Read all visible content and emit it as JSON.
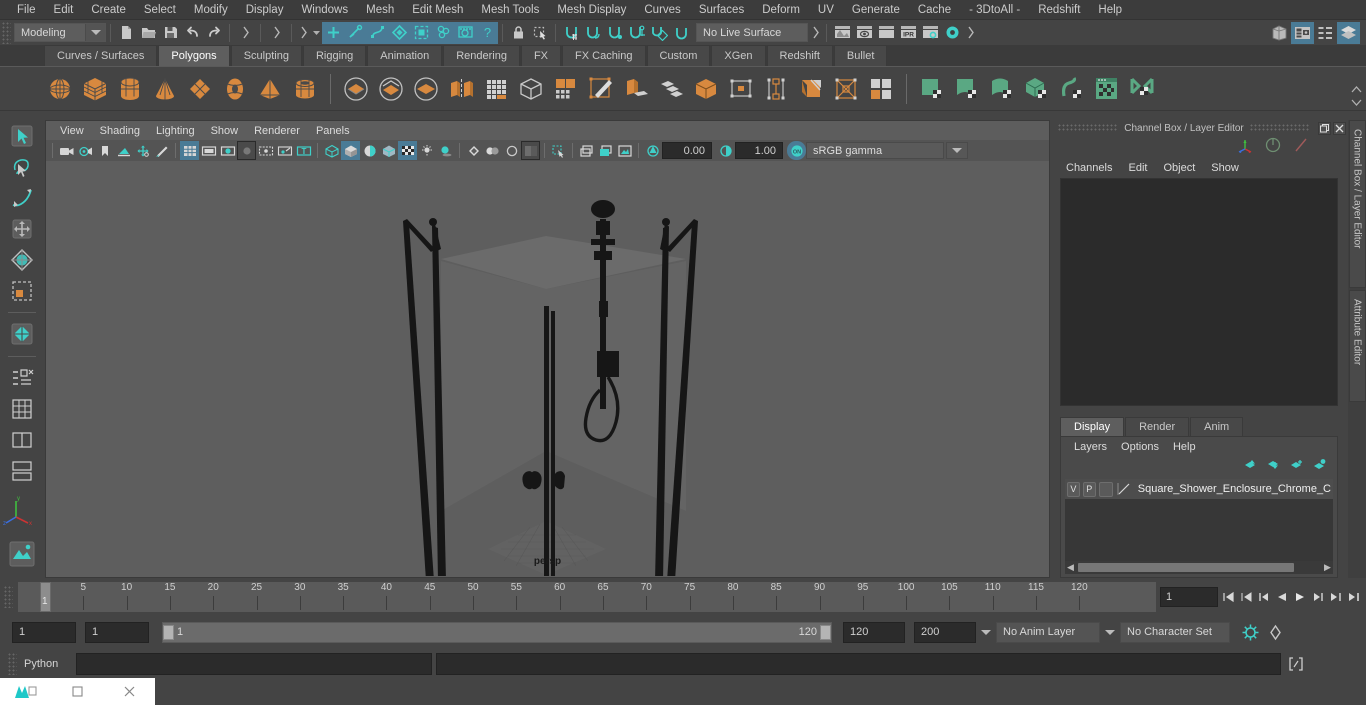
{
  "app": {
    "name": "Autodesk Maya"
  },
  "menubar": {
    "items": [
      "File",
      "Edit",
      "Create",
      "Select",
      "Modify",
      "Display",
      "Windows",
      "Mesh",
      "Edit Mesh",
      "Mesh Tools",
      "Mesh Display",
      "Curves",
      "Surfaces",
      "Deform",
      "UV",
      "Generate",
      "Cache",
      "- 3DtoAll -",
      "Redshift",
      "Help"
    ]
  },
  "statusline": {
    "menuset": "Modeling",
    "live_surface": "No Live Surface",
    "ipr_label": "IPR",
    "icons": [
      "new-scene-icon",
      "open-scene-icon",
      "save-scene-icon",
      "undo-icon",
      "redo-icon",
      "select-by-hierarchy-icon",
      "select-by-object-icon",
      "select-by-component-icon",
      "select-mask-vertex-icon",
      "select-mask-edge-icon",
      "select-mask-face-icon",
      "select-mask-uv-icon",
      "select-mask-help-icon",
      "lock-selection-icon",
      "highlight-selection-icon",
      "snap-to-grid-icon",
      "snap-to-curve-icon",
      "snap-to-point-icon",
      "snap-to-projected-center-icon",
      "snap-to-view-plane-icon",
      "snap-to-active-object-icon",
      "render-view-icon",
      "render-current-frame-icon",
      "ipr-render-icon",
      "render-settings-icon",
      "hypershade-icon",
      "sidebar-attribute-editor-icon",
      "sidebar-tool-settings-icon",
      "sidebar-channel-box-icon",
      "sidebar-layer-editor-icon"
    ]
  },
  "shelf": {
    "tabs": [
      "Curves / Surfaces",
      "Polygons",
      "Sculpting",
      "Rigging",
      "Animation",
      "Rendering",
      "FX",
      "FX Caching",
      "Custom",
      "XGen",
      "Redshift",
      "Bullet"
    ],
    "active_tab": "Polygons",
    "icons": [
      "poly-sphere-icon",
      "poly-cube-icon",
      "poly-cylinder-icon",
      "poly-cone-icon",
      "poly-plane-icon",
      "poly-torus-icon",
      "poly-pyramid-icon",
      "poly-pipe-icon",
      "sculpt-sphere-icon",
      "boolean-union-icon",
      "boolean-difference-icon",
      "combine-icon",
      "smooth-icon",
      "mirror-icon",
      "extrude-icon",
      "bevel-icon",
      "multi-cut-icon",
      "wedge-icon",
      "bridge-icon",
      "fill-hole-icon",
      "append-polygon-icon",
      "insert-edge-loop-icon",
      "offset-edge-loop-icon",
      "slide-edge-icon",
      "crease-tool-icon",
      "poly-uv-editor-icon",
      "quad-draw-icon",
      "surface-quad-icon",
      "surface-curved-icon",
      "surface-cube-icon",
      "surface-curve-icon",
      "texture-window-icon",
      "uv-snapshot-icon"
    ]
  },
  "toolbox": {
    "items": [
      "select-tool",
      "lasso-select-tool",
      "paint-select-tool",
      "move-tool",
      "rotate-tool",
      "scale-tool",
      "last-tool-used",
      "poly-select-icon",
      "snap-align-icon",
      "layout-single-icon",
      "layout-four-view-icon",
      "layout-persp-outliner-icon",
      "layout-hypergraph-icon"
    ]
  },
  "viewport": {
    "menus": [
      "View",
      "Shading",
      "Lighting",
      "Show",
      "Renderer",
      "Panels"
    ],
    "toolbar": {
      "exposure_value": "0.00",
      "gamma_value": "1.00",
      "color_management": "sRGB gamma",
      "gamma_toggle": "ON",
      "icons": [
        "select-camera-icon",
        "camera-attributes-icon",
        "bookmark-icon",
        "image-plane-icon",
        "2d-pan-zoom-icon",
        "grease-pencil-icon",
        "grid-toggle-icon",
        "film-gate-icon",
        "resolution-gate-icon",
        "gate-mask-icon",
        "film-origin-icon",
        "safe-action-icon",
        "text-overlay-icon",
        "wireframe-icon",
        "smooth-shade-icon",
        "shaded-wireframe-icon",
        "textured-icon",
        "use-default-material-icon",
        "lighting-icon",
        "shadows-icon",
        "screen-space-ao-icon",
        "motion-blur-icon",
        "multisample-icon",
        "xray-icon",
        "xray-joints-icon",
        "isolate-select-icon",
        "view-panel-1-icon",
        "view-panel-2-icon",
        "view-panel-3-icon",
        "exposure-icon",
        "gamma-icon",
        "color-management-toggle-icon"
      ]
    },
    "camera_label": "persp"
  },
  "right_panel": {
    "title": "Channel Box / Layer Editor",
    "window_buttons": [
      "restore-icon",
      "close-icon"
    ],
    "channel_menus": [
      "Channels",
      "Edit",
      "Object",
      "Show"
    ],
    "mode_icons": [
      "manipulator-icon",
      "default-manip-icon",
      "no-manip-icon"
    ],
    "layer_tabs": [
      "Display",
      "Render",
      "Anim"
    ],
    "active_layer_tab": "Display",
    "layer_menus": [
      "Layers",
      "Options",
      "Help"
    ],
    "layer_icons": [
      "move-layer-up-icon",
      "move-layer-down-icon",
      "new-layer-icon",
      "new-layer-from-selected-icon"
    ],
    "layers": [
      {
        "visibility": "V",
        "playback": "P",
        "shade": "",
        "name": "Square_Shower_Enclosure_Chrome_C"
      }
    ],
    "side_tabs": [
      "Channel Box / Layer Editor",
      "Attribute Editor"
    ]
  },
  "timeline": {
    "ticks": [
      5,
      10,
      15,
      20,
      25,
      30,
      35,
      40,
      45,
      50,
      55,
      60,
      65,
      70,
      75,
      80,
      85,
      90,
      95,
      100,
      105,
      110,
      115,
      120
    ],
    "current_frame_label": "1",
    "current_frame_field": "1",
    "transport_icons": [
      "go-to-start-icon",
      "step-back-key-icon",
      "step-back-frame-icon",
      "play-backwards-icon",
      "play-forwards-icon",
      "step-forward-frame-icon",
      "step-forward-key-icon",
      "go-to-end-icon"
    ]
  },
  "range": {
    "start_field": "1",
    "playback_start_field": "1",
    "bar_start": "1",
    "bar_end": "120",
    "playback_end_field": "120",
    "end_field": "200",
    "anim_layer": "No Anim Layer",
    "character_set": "No Character Set",
    "right_icons": [
      "animation-preferences-icon",
      "auto-keyframe-icon"
    ]
  },
  "command_line": {
    "language_label": "Python",
    "input_value": "",
    "output_value": "",
    "script_editor_icon": "script-editor-icon"
  },
  "taskbar": {
    "items": [
      "maya-app-icon",
      "restore-window-icon",
      "close-window-icon"
    ]
  },
  "colors": {
    "accent_blue": "#4a7b96",
    "shelf_orange": "#d8893f",
    "shelf_green": "#5aa883",
    "panel_bg": "#444444",
    "viewport_bg": "#5e5e5e",
    "dark_field": "#2b2b2b"
  }
}
